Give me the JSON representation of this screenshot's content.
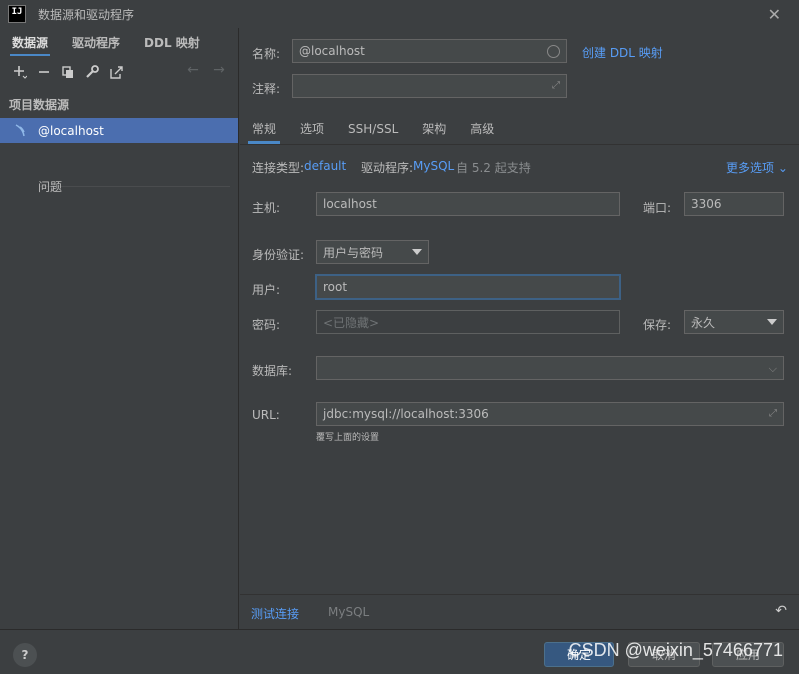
{
  "window": {
    "title": "数据源和驱动程序"
  },
  "left": {
    "tabs": [
      {
        "label": "数据源"
      },
      {
        "label": "驱动程序"
      },
      {
        "label": "DDL 映射"
      }
    ],
    "section_label": "项目数据源",
    "datasource": "@localhost",
    "problems": "问题"
  },
  "form": {
    "name_label": "名称:",
    "name_value": "@localhost",
    "create_ddl_link": "创建 DDL 映射",
    "comment_label": "注释:",
    "tabs": [
      {
        "label": "常规"
      },
      {
        "label": "选项"
      },
      {
        "label": "SSH/SSL"
      },
      {
        "label": "架构"
      },
      {
        "label": "高级"
      }
    ],
    "conn_type_label": "连接类型:",
    "conn_type_value": "default",
    "driver_label": "驱动程序:",
    "driver_value": "MySQL",
    "driver_support": "自 5.2 起支持",
    "more_options": "更多选项",
    "host_label": "主机:",
    "host_value": "localhost",
    "port_label": "端口:",
    "port_value": "3306",
    "auth_label": "身份验证:",
    "auth_value": "用户与密码",
    "user_label": "用户:",
    "user_value": "root",
    "password_label": "密码:",
    "password_placeholder": "<已隐藏>",
    "save_label": "保存:",
    "save_value": "永久",
    "database_label": "数据库:",
    "url_label": "URL:",
    "url_value": "jdbc:mysql://localhost:3306",
    "url_hint": "覆写上面的设置"
  },
  "bottom": {
    "test_connection": "测试连接",
    "driver_name": "MySQL"
  },
  "footer": {
    "help": "?",
    "ok_label": "确定",
    "cancel_label": "取消",
    "apply_label": "应用",
    "watermark": "CSDN @weixin_57466771"
  }
}
